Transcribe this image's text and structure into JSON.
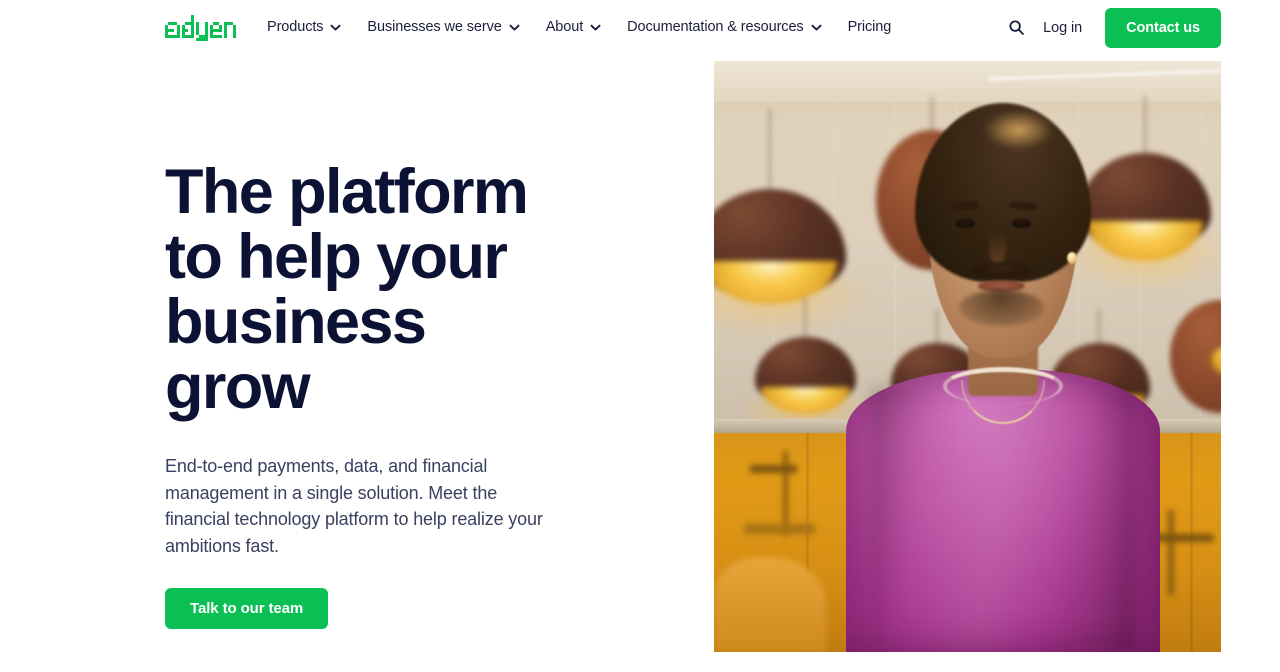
{
  "brand": {
    "name": "adyen",
    "logo_name": "adyen-logo",
    "accent_green": "#0abf53",
    "ink": "#0c1234"
  },
  "header": {
    "nav_items": [
      {
        "label": "Products",
        "has_dropdown": true,
        "icon": "chevron-down-icon"
      },
      {
        "label": "Businesses we serve",
        "has_dropdown": true,
        "icon": "chevron-down-icon"
      },
      {
        "label": "About",
        "has_dropdown": true,
        "icon": "chevron-down-icon"
      },
      {
        "label": "Documentation & resources",
        "has_dropdown": true,
        "icon": "chevron-down-icon"
      },
      {
        "label": "Pricing",
        "has_dropdown": false,
        "icon": ""
      }
    ],
    "search_icon": "search-icon",
    "login_label": "Log in",
    "contact_label": "Contact us"
  },
  "hero": {
    "title": "The platform to help your business grow",
    "subtitle": "End-to-end payments, data, and financial management in a single solution. Meet the financial technology platform to help realize your ambitions fast.",
    "cta_label": "Talk to our team",
    "image_alt": "Person in a purple sweater standing in a room with copper pendant lamps and amber cabinetry"
  }
}
